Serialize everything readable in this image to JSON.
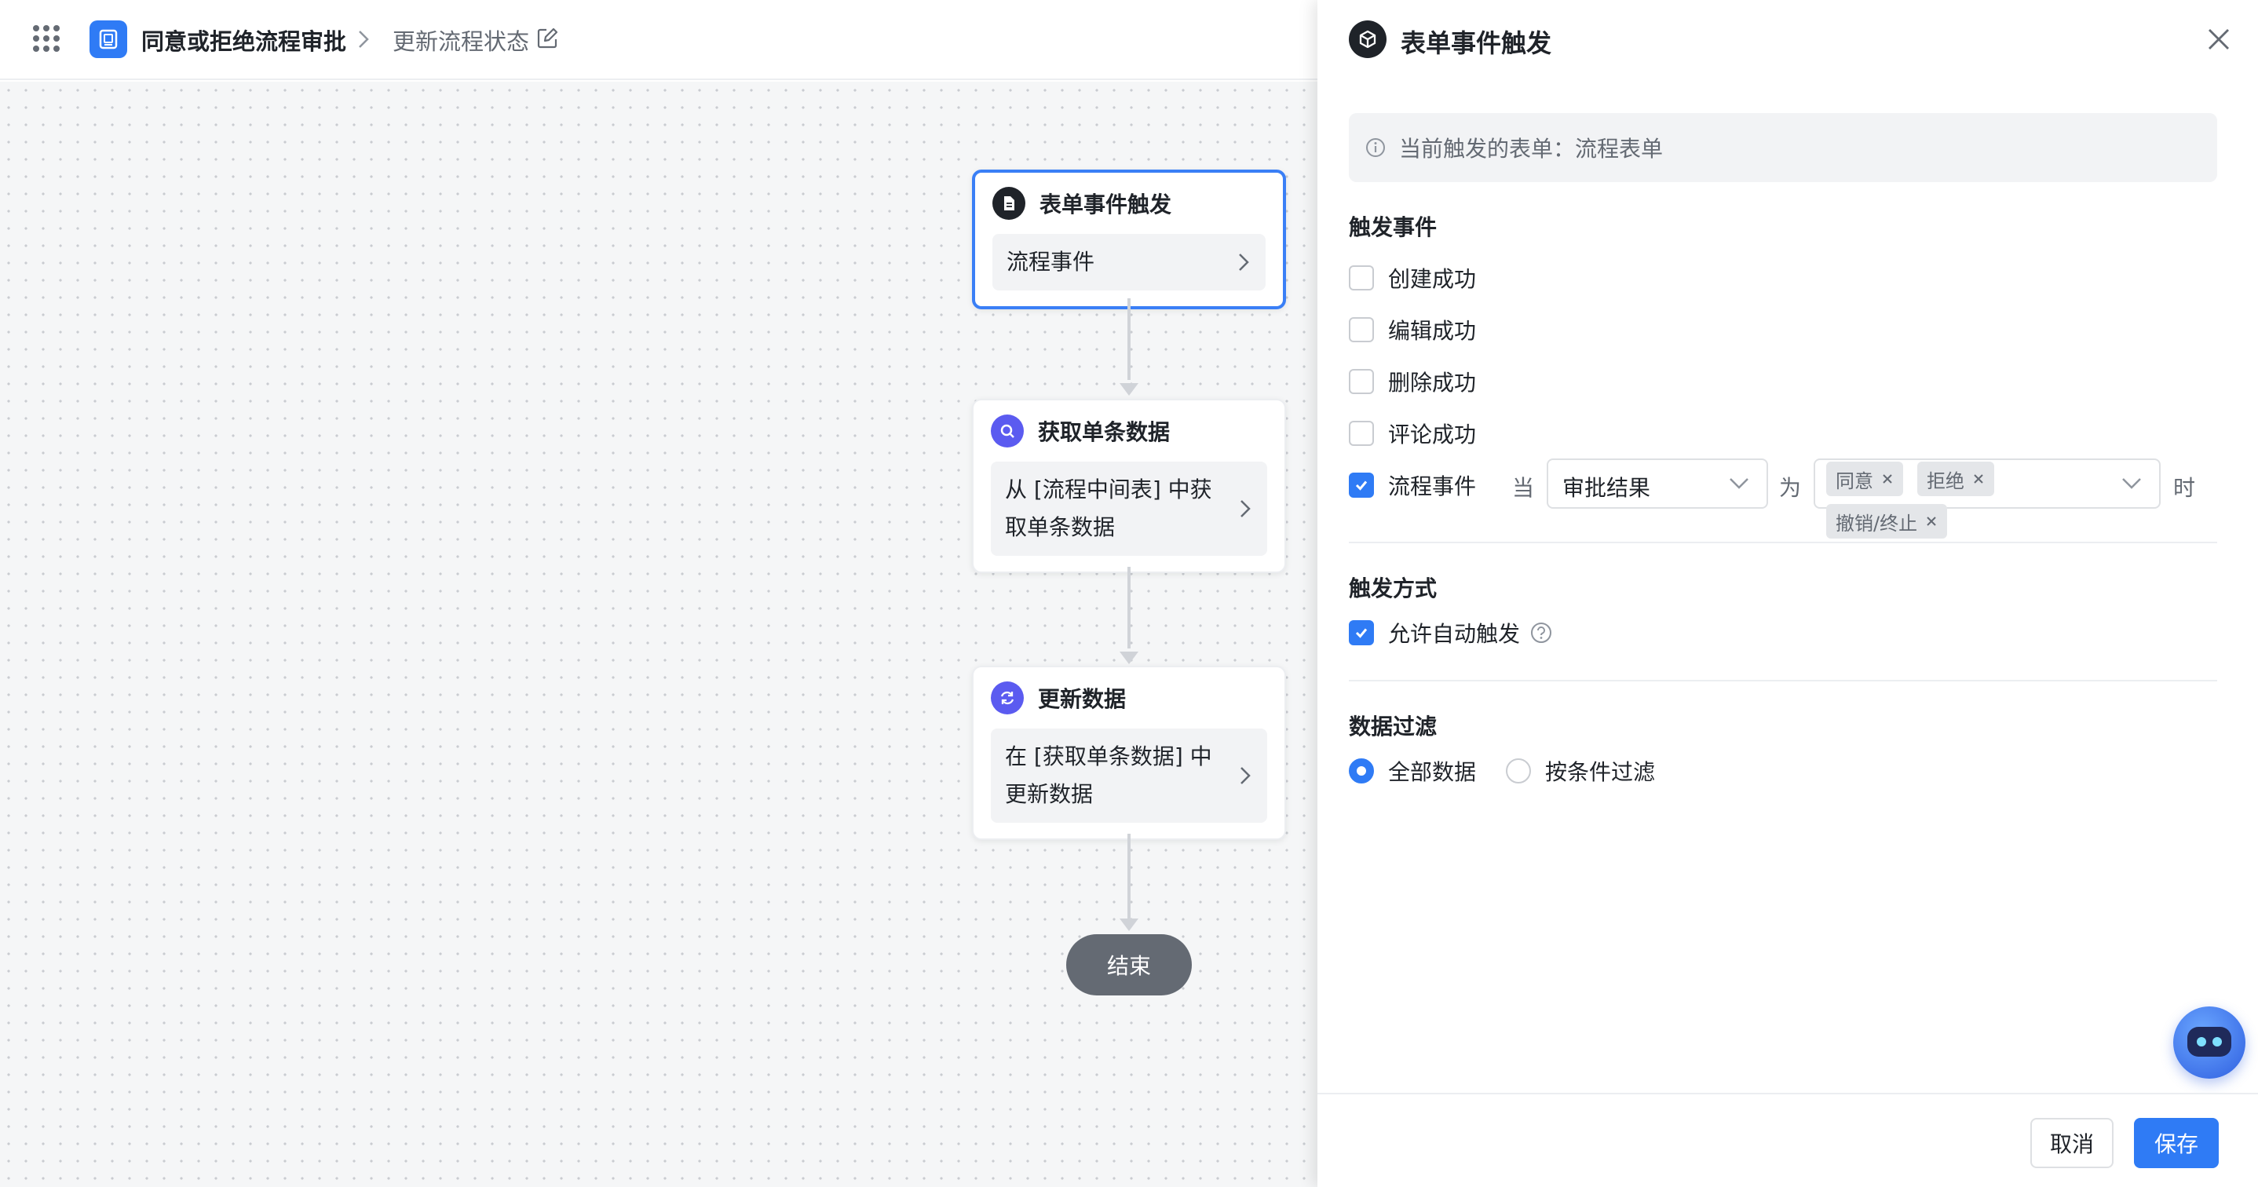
{
  "header": {
    "title": "同意或拒绝流程审批",
    "subtitle": "更新流程状态"
  },
  "flow": {
    "nodes": [
      {
        "title": "表单事件触发",
        "body": "流程事件"
      },
      {
        "title": "获取单条数据",
        "body_line1": "从 [流程中间表] 中获",
        "body_line2": "取单条数据"
      },
      {
        "title": "更新数据",
        "body_line1": "在 [获取单条数据] 中",
        "body_line2": "更新数据"
      }
    ],
    "end_label": "结束"
  },
  "panel": {
    "title": "表单事件触发",
    "info": "当前触发的表单：流程表单",
    "events_title": "触发事件",
    "events": [
      {
        "label": "创建成功",
        "checked": false
      },
      {
        "label": "编辑成功",
        "checked": false
      },
      {
        "label": "删除成功",
        "checked": false
      },
      {
        "label": "评论成功",
        "checked": false
      },
      {
        "label": "流程事件",
        "checked": true
      }
    ],
    "condition": {
      "when_word": "当",
      "field_value": "审批结果",
      "is_word": "为",
      "tags": [
        "同意",
        "拒绝",
        "撤销/终止"
      ],
      "time_word": "时"
    },
    "mode_title": "触发方式",
    "mode_option": {
      "label": "允许自动触发",
      "checked": true
    },
    "filter_title": "数据过滤",
    "filter_options": [
      {
        "label": "全部数据",
        "checked": true
      },
      {
        "label": "按条件过滤",
        "checked": false
      }
    ],
    "buttons": {
      "cancel": "取消",
      "save": "保存"
    }
  },
  "colors": {
    "accent": "#2f7bf5",
    "node_purple": "#5b5bf0",
    "end_node": "#646a73"
  }
}
